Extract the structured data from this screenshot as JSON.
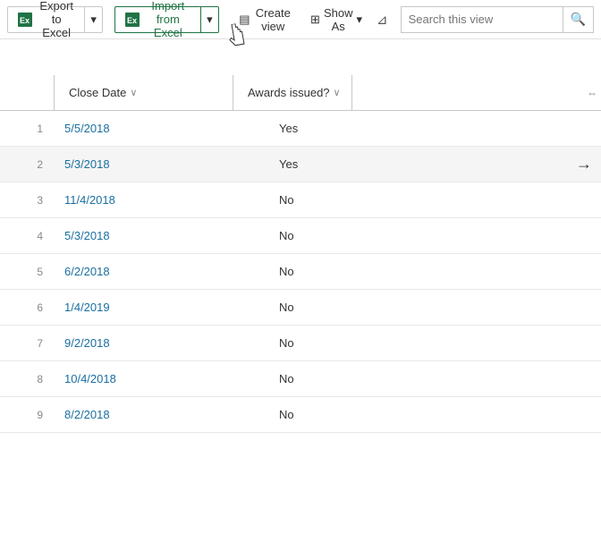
{
  "toolbar": {
    "export_label": "Export to Excel",
    "import_label": "Import from Excel",
    "create_view_label": "Create view",
    "show_as_label": "Show As",
    "search_placeholder": "Search this view"
  },
  "columns": [
    {
      "label": "Close Date",
      "sort": "asc"
    },
    {
      "label": "Awards issued?",
      "sort": "asc"
    }
  ],
  "rows": [
    {
      "date": "5/5/2018",
      "award": "Yes",
      "highlighted": false
    },
    {
      "date": "5/3/2018",
      "award": "Yes",
      "highlighted": true
    },
    {
      "date": "11/4/2018",
      "award": "No",
      "highlighted": false
    },
    {
      "date": "5/3/2018",
      "award": "No",
      "highlighted": false
    },
    {
      "date": "6/2/2018",
      "award": "No",
      "highlighted": false
    },
    {
      "date": "1/4/2019",
      "award": "No",
      "highlighted": false
    },
    {
      "date": "9/2/2018",
      "award": "No",
      "highlighted": false
    },
    {
      "date": "10/4/2018",
      "award": "No",
      "highlighted": false
    },
    {
      "date": "8/2/2018",
      "award": "No",
      "highlighted": false
    }
  ]
}
